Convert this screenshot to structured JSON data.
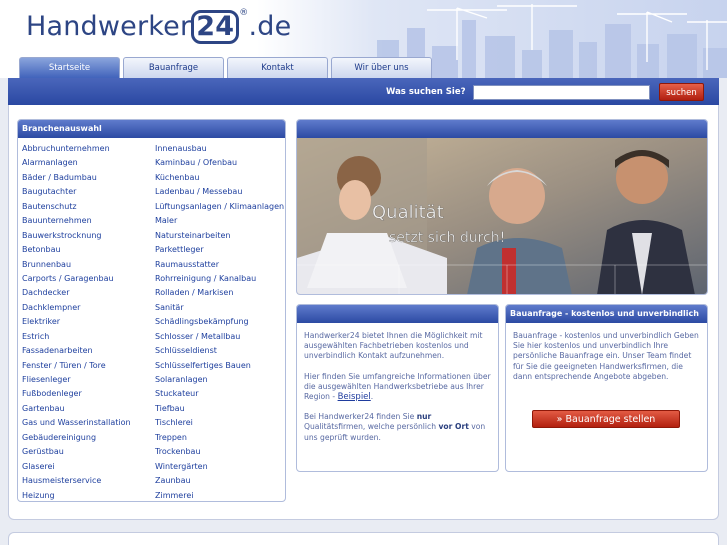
{
  "logo": {
    "left": "Handwerker",
    "num": "24",
    "reg": "®",
    "right": ".de"
  },
  "nav": {
    "tabs": [
      "Startseite",
      "Bauanfrage",
      "Kontakt",
      "Wir über uns"
    ]
  },
  "search": {
    "label": "Was suchen Sie?",
    "value": "",
    "button": "suchen"
  },
  "categories": {
    "title": "Branchenauswahl",
    "col1": [
      "Abbruchunternehmen",
      "Alarmanlagen",
      "Bäder / Badumbau",
      "Baugutachter",
      "Bautenschutz",
      "Bauunternehmen",
      "Bauwerkstrocknung",
      "Betonbau",
      "Brunnenbau",
      "Carports / Garagenbau",
      "Dachdecker",
      "Dachklempner",
      "Elektriker",
      "Estrich",
      "Fassadenarbeiten",
      "Fenster / Türen / Tore",
      "Fliesenleger",
      "Fußbodenleger",
      "Gartenbau",
      "Gas und Wasserinstallation",
      "Gebäudereinigung",
      "Gerüstbau",
      "Glaserei",
      "Hausmeisterservice",
      "Heizung"
    ],
    "col2": [
      "Innenausbau",
      "Kaminbau / Ofenbau",
      "Küchenbau",
      "Ladenbau / Messebau",
      "Lüftungsanlagen / Klimaanlagen",
      "Maler",
      "Natursteinarbeiten",
      "Parkettleger",
      "Raumausstatter",
      "Rohrreinigung / Kanalbau",
      "Rolladen / Markisen",
      "Sanitär",
      "Schädlingsbekämpfung",
      "Schlosser / Metallbau",
      "Schlüsseldienst",
      "Schlüsselfertiges Bauen",
      "Solaranlagen",
      "Stuckateur",
      "Tiefbau",
      "Tischlerei",
      "Treppen",
      "Trockenbau",
      "Wintergärten",
      "Zaunbau",
      "Zimmerei"
    ]
  },
  "banner": {
    "line1": "Qualität",
    "line2": "setzt sich durch!"
  },
  "info": {
    "title": "",
    "p1": "Handwerker24 bietet Ihnen die Möglichkeit mit ausgewählten Fachbetrieben kostenlos und unverbindlich Kontakt aufzunehmen.",
    "p2": "Hier finden Sie umfangreiche Informationen über die ausgewählten Handwerksbetriebe aus Ihrer Region -",
    "p2_link": "Beispiel",
    "p2_end": ".",
    "p3_a": "Bei Handwerker24 finden Sie ",
    "p3_b": "nur",
    "p3_c": " Qualitätsfirmen, welche persönlich ",
    "p3_d": "vor Ort",
    "p3_e": " von uns geprüft wurden."
  },
  "request": {
    "title": "Bauanfrage - kostenlos und unverbindlich",
    "text": "Bauanfrage - kostenlos und unverbindlich Geben Sie hier kostenlos und unverbindlich Ihre persönliche Bauanfrage ein. Unser Team findet für Sie die geeigneten Handwerksfirmen, die dann entsprechende Angebote abgeben.",
    "button": "» Bauanfrage stellen"
  }
}
